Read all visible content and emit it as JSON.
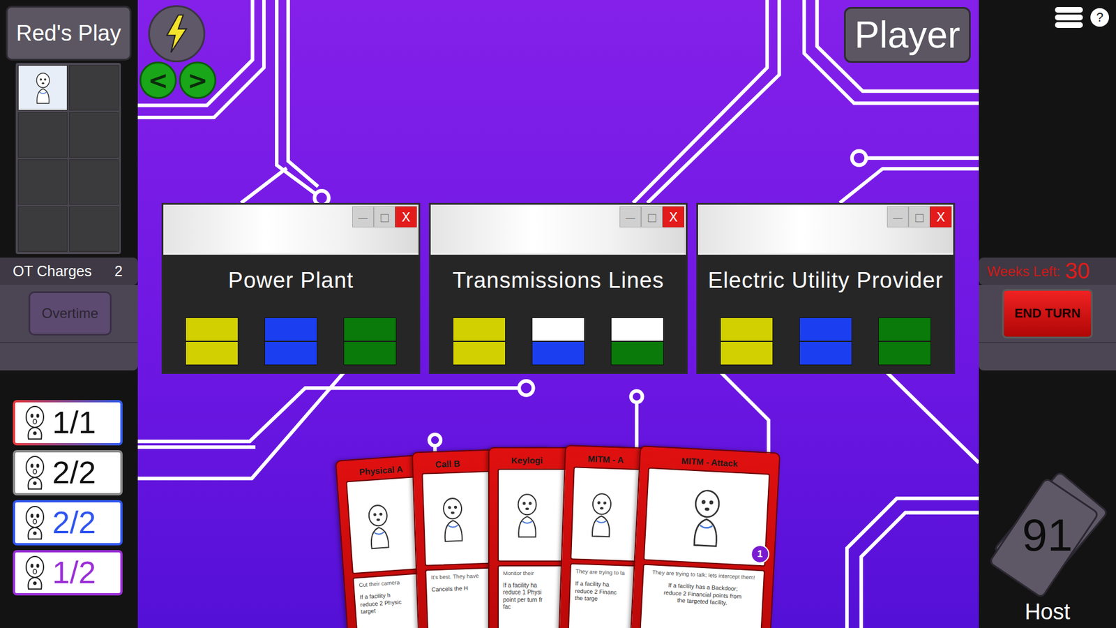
{
  "left_panel": {
    "play_button": "Red's Play",
    "slots": [
      {
        "filled": true
      },
      {
        "filled": false
      },
      {
        "filled": false
      },
      {
        "filled": false
      },
      {
        "filled": false
      },
      {
        "filled": false
      },
      {
        "filled": false
      },
      {
        "filled": false
      }
    ],
    "ot_charges": {
      "label": "OT Charges",
      "value": "2"
    },
    "overtime_button": "Overtime",
    "players": [
      {
        "count": "1/1",
        "colors": [
          "#e8383a",
          "#2f5cf0"
        ],
        "text_color": "#111111"
      },
      {
        "count": "2/2",
        "colors": [
          "#8a8a8a"
        ],
        "text_color": "#111111"
      },
      {
        "count": "2/2",
        "colors": [
          "#2f55f0"
        ],
        "text_color": "#2f55f0"
      },
      {
        "count": "1/2",
        "colors": [
          "#9a2fd6"
        ],
        "text_color": "#9a2fd6"
      }
    ]
  },
  "toolbar": {
    "prev": "<",
    "next": ">",
    "player_button": "Player"
  },
  "window_controls": {
    "minimize": "—",
    "maximize": "□",
    "close": "X"
  },
  "facilities": [
    {
      "name": "Power Plant",
      "stats": [
        {
          "color": "#d2d000",
          "level": 1
        },
        {
          "color": "#1b3ff0",
          "level": 1
        },
        {
          "color": "#0a7a0a",
          "level": 1
        }
      ]
    },
    {
      "name": "Transmissions Lines",
      "stats": [
        {
          "color": "#d2d000",
          "level": 1
        },
        {
          "color": "#1b3ff0",
          "level": 0.5
        },
        {
          "color": "#0a7a0a",
          "level": 0.5
        }
      ]
    },
    {
      "name": "Electric Utility Provider",
      "stats": [
        {
          "color": "#d2d000",
          "level": 1
        },
        {
          "color": "#1b3ff0",
          "level": 1
        },
        {
          "color": "#0a7a0a",
          "level": 1
        }
      ]
    }
  ],
  "hand": [
    {
      "title": "Physical A",
      "flavor": "Cut their camera",
      "effect": [
        "If a facility h",
        "reduce 2 Physic",
        "target"
      ]
    },
    {
      "title": "Call B",
      "flavor": "It's best. They have",
      "effect": [
        "Cancels the H"
      ]
    },
    {
      "title": "Keylogi",
      "flavor": "Monitor their",
      "effect": [
        "If a facility ha",
        "reduce 1 Physi",
        "point per turn fr",
        "fac"
      ]
    },
    {
      "title": "MITM - A",
      "flavor": "They are trying to ta",
      "effect": [
        "If a facility ha",
        "reduce 2 Financ",
        "the targe"
      ]
    },
    {
      "title": "MITM - Attack",
      "flavor": "They are trying to talk; lets intercept them!",
      "effect": [
        "If a facility has a Backdoor;",
        "reduce 2 Financial points from",
        "the targeted facility."
      ],
      "badge": "1"
    }
  ],
  "right_panel": {
    "help": "?",
    "weeks_label": "Weeks Left:",
    "weeks_value": "30",
    "end_turn": "END TURN",
    "deck_count": "91",
    "deck_owner": "Host"
  }
}
